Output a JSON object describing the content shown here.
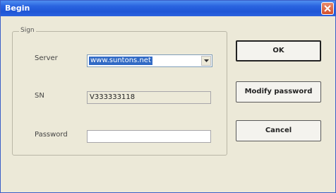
{
  "window": {
    "title": "Begin"
  },
  "group": {
    "caption": "Sign"
  },
  "fields": {
    "server_label": "Server",
    "server_value": "www.suntons.net",
    "sn_label": "SN",
    "sn_value": "V333333118",
    "password_label": "Password",
    "password_value": ""
  },
  "buttons": {
    "ok_label": "OK",
    "modify_label": "Modify password",
    "cancel_label": "Cancel"
  },
  "icons": {
    "close": "close-icon",
    "dropdown": "chevron-down-icon"
  },
  "colors": {
    "titlebar": "#2a64e0",
    "close": "#d4502c",
    "selection": "#316ac5",
    "window_bg": "#ece9d8"
  }
}
